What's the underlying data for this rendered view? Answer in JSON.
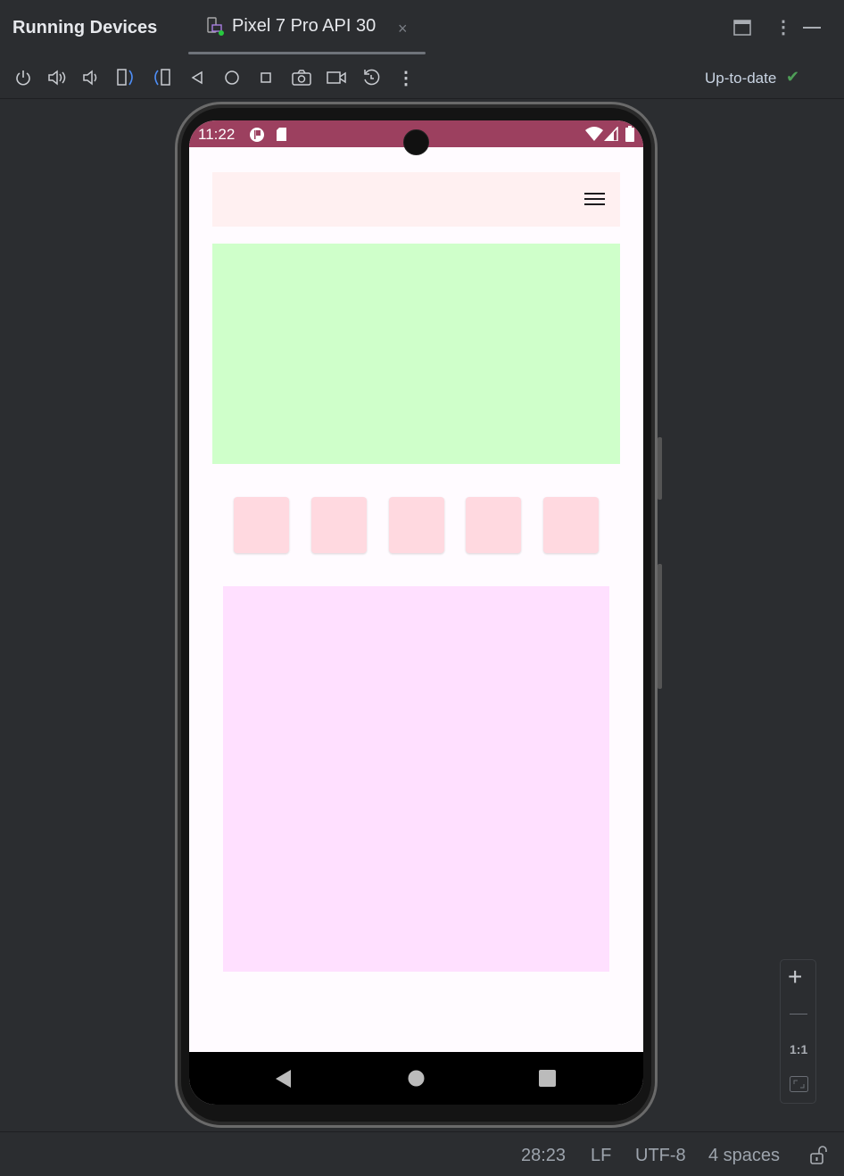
{
  "header": {
    "title": "Running Devices",
    "tab_label": "Pixel 7 Pro API 30",
    "tab_close": "×"
  },
  "toolbar": {
    "icons": [
      "power-icon",
      "volume-up-icon",
      "volume-down-icon",
      "rotate-left-icon",
      "rotate-right-icon",
      "back-icon",
      "home-icon",
      "overview-icon",
      "screenshot-icon",
      "screen-record-icon",
      "reset-icon",
      "more-icon"
    ],
    "status": "Up-to-date",
    "status_color": "#4e9e57"
  },
  "device": {
    "time": "11:22",
    "status_bar_color": "#9c405f",
    "screen_bg": "#fffbff",
    "top_bar_color": "#fff0f1",
    "banner_color": "#cfffca",
    "tile_color": "#ffd9e0",
    "panel_color": "#ffe0ff"
  },
  "zoom": {
    "plus": "+",
    "minus": "—",
    "actual": "1:1"
  },
  "statusbar": {
    "position": "28:23",
    "line_ending": "LF",
    "encoding": "UTF-8",
    "indent": "4 spaces"
  }
}
